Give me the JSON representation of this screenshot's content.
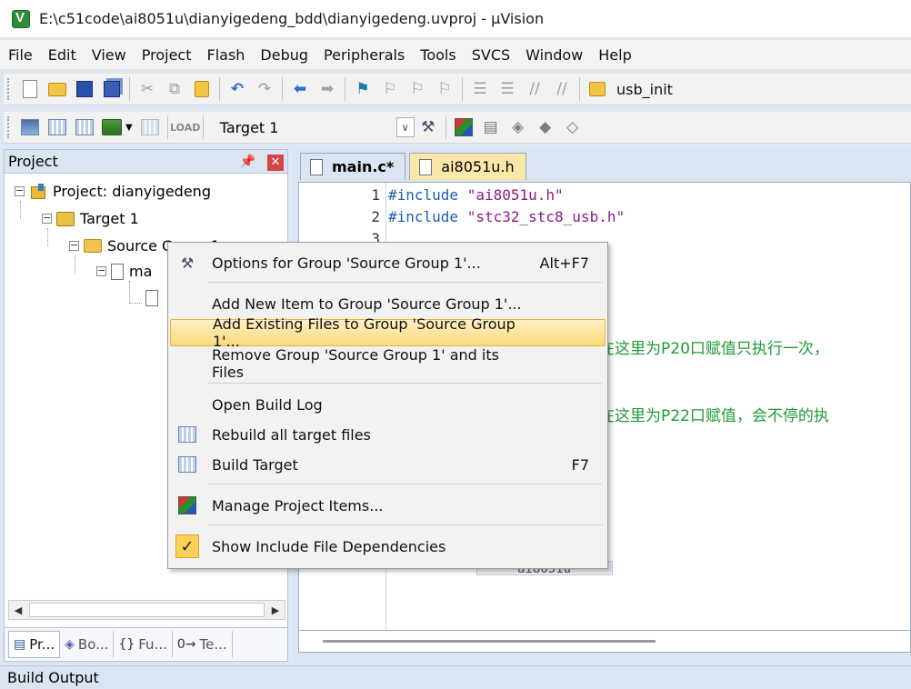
{
  "window": {
    "title": "E:\\c51code\\ai8051u\\dianyigedeng_bdd\\dianyigedeng.uvproj - µVision"
  },
  "menubar": {
    "items": [
      "File",
      "Edit",
      "View",
      "Project",
      "Flash",
      "Debug",
      "Peripherals",
      "Tools",
      "SVCS",
      "Window",
      "Help"
    ]
  },
  "toolbar1": {
    "find_text": "usb_init"
  },
  "toolbar2": {
    "target": "Target 1",
    "load_label": "LOAD"
  },
  "project_panel": {
    "title": "Project",
    "tree": {
      "project": "Project: dianyigedeng",
      "target": "Target 1",
      "group": "Source Group 1",
      "file": "ma"
    },
    "tabs": [
      "Pr...",
      "Bo...",
      "Fu...",
      "Te..."
    ]
  },
  "editor": {
    "tabs": [
      {
        "label": "main.c*"
      },
      {
        "label": "ai8051u.h"
      }
    ],
    "line_numbers": [
      "1",
      "2",
      "3"
    ],
    "lines": [
      {
        "kw": "#include",
        "str": "\"ai8051u.h\""
      },
      {
        "kw": "#include",
        "str": "\"stc32_stc8_usb.h\""
      }
    ],
    "comment1": "在这里为P20口赋值只执行一次，",
    "comment2": "在这里为P22口赋值，会不停的执",
    "fragment": "ai8051u"
  },
  "context_menu": {
    "items": [
      {
        "label": "Options for Group 'Source Group 1'...",
        "shortcut": "Alt+F7"
      },
      {
        "label": "Add New  Item to Group 'Source Group 1'...",
        "shortcut": ""
      },
      {
        "label": "Add Existing Files to Group 'Source Group 1'...",
        "shortcut": ""
      },
      {
        "label": "Remove Group 'Source Group 1' and its Files",
        "shortcut": ""
      },
      {
        "label": "Open Build Log",
        "shortcut": ""
      },
      {
        "label": "Rebuild all target files",
        "shortcut": ""
      },
      {
        "label": "Build Target",
        "shortcut": "F7"
      },
      {
        "label": "Manage Project Items...",
        "shortcut": ""
      },
      {
        "label": "Show Include File Dependencies",
        "shortcut": ""
      }
    ],
    "highlighted_index": 2,
    "checked_item": "Show Include File Dependencies"
  },
  "build_output": {
    "title": "Build Output"
  },
  "colors": {
    "accent": "#dbe5f1",
    "highlight": "#fbd97c",
    "comment": "#1f9a38",
    "keyword": "#1c5fb0",
    "string": "#8b1a8b"
  }
}
